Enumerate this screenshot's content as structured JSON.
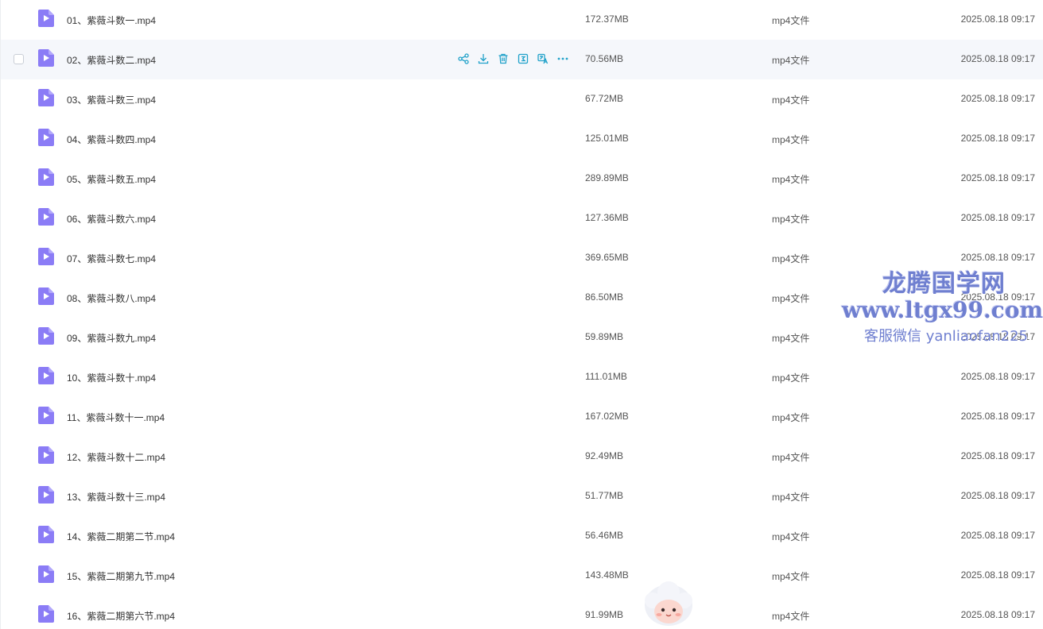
{
  "files": [
    {
      "name": "01、紫薇斗数一.mp4",
      "size": "172.37MB",
      "type": "mp4文件",
      "date": "2025.08.18 09:17"
    },
    {
      "name": "02、紫薇斗数二.mp4",
      "size": "70.56MB",
      "type": "mp4文件",
      "date": "2025.08.18 09:17"
    },
    {
      "name": "03、紫薇斗数三.mp4",
      "size": "67.72MB",
      "type": "mp4文件",
      "date": "2025.08.18 09:17"
    },
    {
      "name": "04、紫薇斗数四.mp4",
      "size": "125.01MB",
      "type": "mp4文件",
      "date": "2025.08.18 09:17"
    },
    {
      "name": "05、紫薇斗数五.mp4",
      "size": "289.89MB",
      "type": "mp4文件",
      "date": "2025.08.18 09:17"
    },
    {
      "name": "06、紫薇斗数六.mp4",
      "size": "127.36MB",
      "type": "mp4文件",
      "date": "2025.08.18 09:17"
    },
    {
      "name": "07、紫薇斗数七.mp4",
      "size": "369.65MB",
      "type": "mp4文件",
      "date": "2025.08.18 09:17"
    },
    {
      "name": "08、紫薇斗数八.mp4",
      "size": "86.50MB",
      "type": "mp4文件",
      "date": "2025.08.18 09:17"
    },
    {
      "name": "09、紫薇斗数九.mp4",
      "size": "59.89MB",
      "type": "mp4文件",
      "date": "2025.08.18 09:17"
    },
    {
      "name": "10、紫薇斗数十.mp4",
      "size": "111.01MB",
      "type": "mp4文件",
      "date": "2025.08.18 09:17"
    },
    {
      "name": "11、紫薇斗数十一.mp4",
      "size": "167.02MB",
      "type": "mp4文件",
      "date": "2025.08.18 09:17"
    },
    {
      "name": "12、紫薇斗数十二.mp4",
      "size": "92.49MB",
      "type": "mp4文件",
      "date": "2025.08.18 09:17"
    },
    {
      "name": "13、紫薇斗数十三.mp4",
      "size": "51.77MB",
      "type": "mp4文件",
      "date": "2025.08.18 09:17"
    },
    {
      "name": "14、紫薇二期第二节.mp4",
      "size": "56.46MB",
      "type": "mp4文件",
      "date": "2025.08.18 09:17"
    },
    {
      "name": "15、紫薇二期第九节.mp4",
      "size": "143.48MB",
      "type": "mp4文件",
      "date": "2025.08.18 09:17"
    },
    {
      "name": "16、紫薇二期第六节.mp4",
      "size": "91.99MB",
      "type": "mp4文件",
      "date": "2025.08.18 09:17"
    }
  ],
  "hovered_row_index": 1,
  "row_actions": [
    "share-icon",
    "download-icon",
    "delete-icon",
    "summary-icon",
    "translate-icon",
    "more-icon"
  ],
  "watermark": {
    "line1": "龙腾国学网",
    "line2": "www.ltgx99.com",
    "line3": "客服微信 yanliaofan225"
  },
  "colors": {
    "accent": "#1fa1c9",
    "video_icon": "#8b7cf6",
    "hover_row": "#f5f7fb",
    "watermark": "#6f7fd0"
  }
}
